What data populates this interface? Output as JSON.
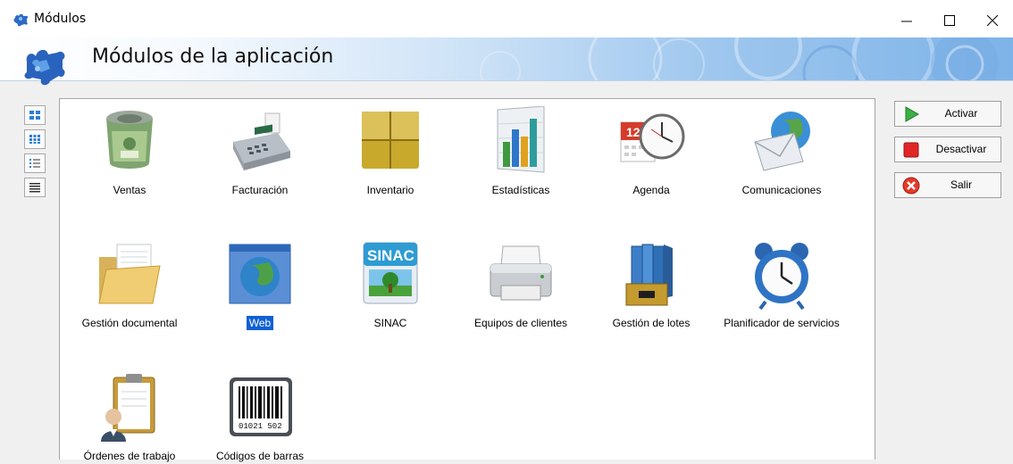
{
  "window": {
    "title": "Módulos",
    "controls": [
      "minimize",
      "maximize",
      "close"
    ]
  },
  "banner": {
    "title": "Módulos de la aplicación"
  },
  "view_buttons": [
    "large-icons-view",
    "small-icons-view",
    "list-view",
    "details-view"
  ],
  "modules": [
    {
      "label": "Ventas",
      "icon": "money-roll-icon"
    },
    {
      "label": "Facturación",
      "icon": "cash-register-icon"
    },
    {
      "label": "Inventario",
      "icon": "boxes-icon"
    },
    {
      "label": "Estadísticas",
      "icon": "bar-chart-icon"
    },
    {
      "label": "Agenda",
      "icon": "calendar-clock-icon"
    },
    {
      "label": "Comunicaciones",
      "icon": "envelope-globe-icon"
    },
    {
      "label": "Gestión documental",
      "icon": "folder-icon"
    },
    {
      "label": "Web",
      "icon": "globe-window-icon",
      "selected": true
    },
    {
      "label": "SINAC",
      "icon": "sinac-icon",
      "badge": "SINAC"
    },
    {
      "label": "Equipos de clientes",
      "icon": "printer-icon"
    },
    {
      "label": "Gestión de lotes",
      "icon": "binders-icon"
    },
    {
      "label": "Planificador de servicios",
      "icon": "alarm-clock-icon"
    },
    {
      "label": "Órdenes de trabajo",
      "icon": "clipboard-worker-icon"
    },
    {
      "label": "Códigos de barras",
      "icon": "barcode-icon",
      "barcode_text": "01021 502"
    }
  ],
  "actions": [
    {
      "label": "Activar",
      "icon": "play-green-icon"
    },
    {
      "label": "Desactivar",
      "icon": "stop-red-icon"
    },
    {
      "label": "Salir",
      "icon": "close-red-icon"
    }
  ],
  "colors": {
    "selection": "#0f5fd6",
    "banner_blue": "#7db3e8"
  }
}
